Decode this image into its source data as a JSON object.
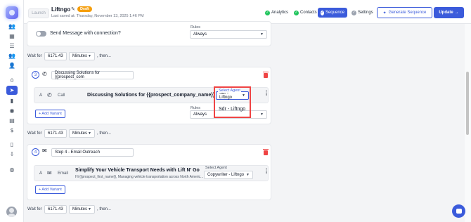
{
  "header": {
    "launch_label": "Launch",
    "sequence_name": "Liftngo",
    "draft_badge": "Draft",
    "last_saved": "Last saved at: Thursday, November 13, 2025 1:46 PM",
    "tabs": [
      {
        "label": "Analytics",
        "icon": "check-circle-icon"
      },
      {
        "label": "Contacts",
        "icon": "check-circle-icon"
      },
      {
        "label": "Sequence",
        "icon": "check-circle-icon"
      },
      {
        "label": "Settings",
        "icon": "check-circle-icon"
      }
    ],
    "generate_label": "Generate Sequence",
    "update_label": "Update"
  },
  "step_top": {
    "toggle_label": "Send Message with connection?",
    "rules_label": "Rules",
    "rules_value": "Always"
  },
  "waits": [
    {
      "label": "Wait for",
      "value": "6171.43",
      "unit": "Minutes",
      "then": ", then..."
    },
    {
      "label": "Wait for",
      "value": "6171.43",
      "unit": "Minutes",
      "then": ", then..."
    },
    {
      "label": "Wait for",
      "value": "6171.43",
      "unit": "Minutes",
      "then": ", then..."
    }
  ],
  "step3": {
    "number": "3",
    "icon": "phone-icon",
    "title": "Discussing Solutions for {{prospect_com",
    "variant_letter": "A",
    "variant_type": "Call",
    "variant_subject": "Discussing Solutions for {{prospect_company_name}}",
    "agent_label": "Select Agent",
    "agent_value": "Sdr - Liftngo",
    "dropdown_option": "Sdr - Liftngo",
    "rules_label": "Rules",
    "rules_value": "Always",
    "add_variant_label": "+ Add Variant"
  },
  "step4": {
    "number": "4",
    "icon": "mail-icon",
    "title": "Step 4 - Email Outreach",
    "variant_letter": "A",
    "variant_type": "Email",
    "variant_subject": "Simplify Your Vehicle Transport Needs with Lift N' Go",
    "variant_body": "Hi {{prospect_first_name}}, Managing vehicle transportation across North Americ...",
    "agent_label": "Select Agent",
    "agent_value": "Copywriter - Liftngo",
    "add_variant_label": "+ Add Variant"
  },
  "colors": {
    "accent": "#3b5bdb",
    "draft": "#f59e0b",
    "danger": "#ef4444",
    "success": "#22c55e"
  }
}
